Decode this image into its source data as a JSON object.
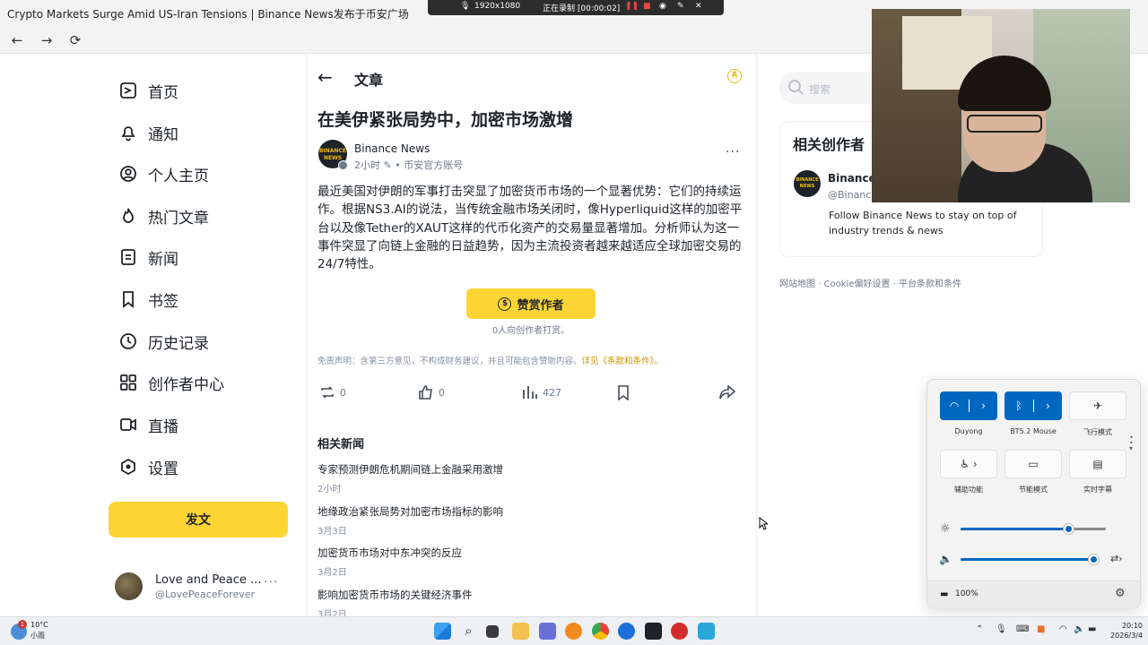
{
  "browser": {
    "tab_title": "Crypto Markets Surge Amid US-Iran Tensions | Binance News发布于币安广场",
    "back_label": "←",
    "forward_label": "→",
    "reload_label": "⟳"
  },
  "recorder": {
    "resolution": "1920x1080",
    "status": "正在录制 [00:00:02]"
  },
  "sidebar": {
    "items": [
      {
        "label": "首页",
        "icon": "home-icon"
      },
      {
        "label": "通知",
        "icon": "bell-icon"
      },
      {
        "label": "个人主页",
        "icon": "user-icon"
      },
      {
        "label": "热门文章",
        "icon": "flame-icon"
      },
      {
        "label": "新闻",
        "icon": "news-icon"
      },
      {
        "label": "书签",
        "icon": "bookmark-icon"
      },
      {
        "label": "历史记录",
        "icon": "clock-icon"
      },
      {
        "label": "创作者中心",
        "icon": "grid-icon"
      },
      {
        "label": "直播",
        "icon": "video-icon"
      },
      {
        "label": "设置",
        "icon": "settings-icon"
      }
    ],
    "post_button": "发文",
    "profile": {
      "name": "Love and Peace ...",
      "handle": "@LovePeaceForever",
      "more": "···"
    }
  },
  "article": {
    "header_title": "文章",
    "header_back": "←",
    "header_badge": "A",
    "title": "在美伊紧张局势中，加密市场激增",
    "author": {
      "logo_text": "BINANCE NEWS",
      "name": "Binance News",
      "meta": "2小时 ✎ • 币安官方账号",
      "more": "···"
    },
    "body": "最近美国对伊朗的军事打击突显了加密货币市场的一个显著优势：它们的持续运作。根据NS3.AI的说法，当传统金融市场关闭时，像Hyperliquid这样的加密平台以及像Tether的XAUT这样的代币化资产的交易量显著增加。分析师认为这一事件突显了向链上金融的日益趋势，因为主流投资者越来越适应全球加密交易的24/7特性。",
    "tip_button": "赞赏作者",
    "tip_coin": "$",
    "tip_count": "0人向创作者打赏。",
    "disclaimer": "免责声明：含第三方意见，不构成财务建议，并且可能包含赞助内容。",
    "disclaimer_link": "详见《条款和条件》。",
    "actions": {
      "repost_count": "0",
      "like_count": "0",
      "views_count": "427"
    },
    "related_title": "相关新闻",
    "related": [
      {
        "title": "专家预测伊朗危机期间链上金融采用激增",
        "date": "2小时"
      },
      {
        "title": "地缘政治紧张局势对加密市场指标的影响",
        "date": "3月3日"
      },
      {
        "title": "加密货币市场对中东冲突的反应",
        "date": "3月2日"
      },
      {
        "title": "影响加密货币市场的关键经济事件",
        "date": "3月2日"
      }
    ]
  },
  "right": {
    "search_placeholder": "搜索",
    "creators_title": "相关创作者",
    "creator": {
      "logo_text": "BINANCE NEWS",
      "name": "Binance",
      "handle": "@Binanc",
      "desc": "Follow Binance News to stay on top of industry trends & news"
    },
    "footer": "网站地图 · Cookie偏好设置 · 平台条款和条件"
  },
  "quick_settings": {
    "wifi_label": "Duyong",
    "bluetooth_label": "BT5.2 Mouse",
    "airplane_label": "飞行模式",
    "accessibility_label": "辅助功能",
    "battery_saver_label": "节能模式",
    "captions_label": "实时字幕",
    "brightness": 0.74,
    "volume": 0.97,
    "battery": "100%"
  },
  "taskbar": {
    "temperature": "10°C",
    "condition": "小雨",
    "weather_badge": "1",
    "time": "20:10",
    "date": "2026/3/4"
  },
  "colors": {
    "brand_yellow": "#fcd535",
    "link_gold": "#c99400",
    "win_blue": "#0067c0"
  }
}
